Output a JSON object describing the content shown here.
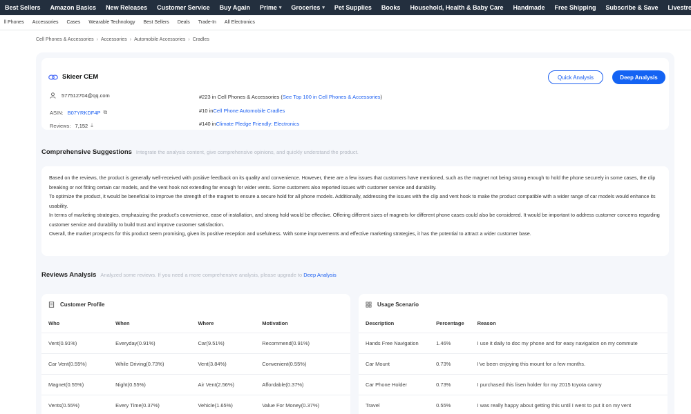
{
  "topnav": [
    {
      "label": "Best Sellers",
      "caret": false
    },
    {
      "label": "Amazon Basics",
      "caret": false
    },
    {
      "label": "New Releases",
      "caret": false
    },
    {
      "label": "Customer Service",
      "caret": false
    },
    {
      "label": "Buy Again",
      "caret": false
    },
    {
      "label": "Prime",
      "caret": true
    },
    {
      "label": "Groceries",
      "caret": true
    },
    {
      "label": "Pet Supplies",
      "caret": false
    },
    {
      "label": "Books",
      "caret": false
    },
    {
      "label": "Household, Health & Baby Care",
      "caret": false
    },
    {
      "label": "Handmade",
      "caret": false
    },
    {
      "label": "Free Shipping",
      "caret": false
    },
    {
      "label": "Subscribe & Save",
      "caret": false
    },
    {
      "label": "Livestreams",
      "caret": false
    }
  ],
  "subnav": [
    "ll Phones",
    "Accessories",
    "Cases",
    "Wearable Technology",
    "Best Sellers",
    "Deals",
    "Trade-In",
    "All Electronics"
  ],
  "breadcrumb": [
    "Cell Phones & Accessories",
    "Accessories",
    "Automobile Accessories",
    "Cradles"
  ],
  "breadcrumb_sep": "›",
  "store": {
    "name": "Skieer CEM"
  },
  "buttons": {
    "quick": "Quick Analysis",
    "deep": "Deep Analysis"
  },
  "info": {
    "email": "577512704@qq.com",
    "asin_label": "ASIN:",
    "asin_value": "B07YRKDF4P",
    "reviews_label": "Reviews:",
    "reviews_value": "7,152",
    "rank1_prefix": "#223 in Cell Phones & Accessories (",
    "rank1_link": "See Top 100 in Cell Phones & Accessories",
    "rank1_suffix": ")",
    "rank2_prefix": "#10 in ",
    "rank2_link": "Cell Phone Automobile Cradles",
    "rank3_prefix": "#140 in ",
    "rank3_link": "Climate Pledge Friendly: Electronics"
  },
  "suggestions": {
    "title": "Comprehensive Suggestions",
    "hint": "Integrate the analysis content, give comprehensive opinions, and quickly understand the product.",
    "paragraphs": [
      "Based on the reviews, the product is generally well-received with positive feedback on its quality and convenience. However, there are a few issues that customers have mentioned, such as the magnet not being strong enough to hold the phone securely in some cases, the clip breaking or not fitting certain car models, and the vent hook not extending far enough for wider vents. Some customers also reported issues with customer service and durability.",
      "To optimize the product, it would be beneficial to improve the strength of the magnet to ensure a secure hold for all phone models. Additionally, addressing the issues with the clip and vent hook to make the product compatible with a wider range of car models would enhance its usability.",
      "In terms of marketing strategies, emphasizing the product's convenience, ease of installation, and strong hold would be effective. Offering different sizes of magnets for different phone cases could also be considered. It would be important to address customer concerns regarding customer service and durability to build trust and improve customer satisfaction.",
      "Overall, the market prospects for this product seem promising, given its positive reception and usefulness. With some improvements and effective marketing strategies, it has the potential to attract a wider customer base."
    ]
  },
  "reviews": {
    "title": "Reviews Analysis",
    "hint": "Analyzed some reviews. If you need a more comprehensive analysis, please upgrade to",
    "hint_link": "Deep Analysis"
  },
  "customer_profile": {
    "title": "Customer Profile",
    "columns": [
      "Who",
      "When",
      "Where",
      "Motivation"
    ],
    "rows": [
      [
        "Vent(0.91%)",
        "Everyday(0.91%)",
        "Car(9.51%)",
        "Recommend(0.91%)"
      ],
      [
        "Car Vent(0.55%)",
        "While Driving(0.73%)",
        "Vent(3.84%)",
        "Convenient(0.55%)"
      ],
      [
        "Magnet(0.55%)",
        "Night(0.55%)",
        "Air Vent(2.56%)",
        "Affordable(0.37%)"
      ],
      [
        "Vents(0.55%)",
        "Every Time(0.37%)",
        "Vehicle(1.65%)",
        "Value For Money(0.37%)"
      ]
    ]
  },
  "usage_scenario": {
    "title": "Usage Scenario",
    "columns": [
      "Description",
      "Percentage",
      "Reason"
    ],
    "rows": [
      [
        "Hands Free Navigation",
        "1.46%",
        "I use it daily to doc my phone and for easy navigation on my commute"
      ],
      [
        "Car Mount",
        "0.73%",
        "I've been enjoying this mount for a few months."
      ],
      [
        "Car Phone Holder",
        "0.73%",
        "I purchased this lisen holder for my 2015 toyota camry"
      ],
      [
        "Travel",
        "0.55%",
        "I was really happy about getting this until I went to put it on my vent"
      ]
    ]
  }
}
